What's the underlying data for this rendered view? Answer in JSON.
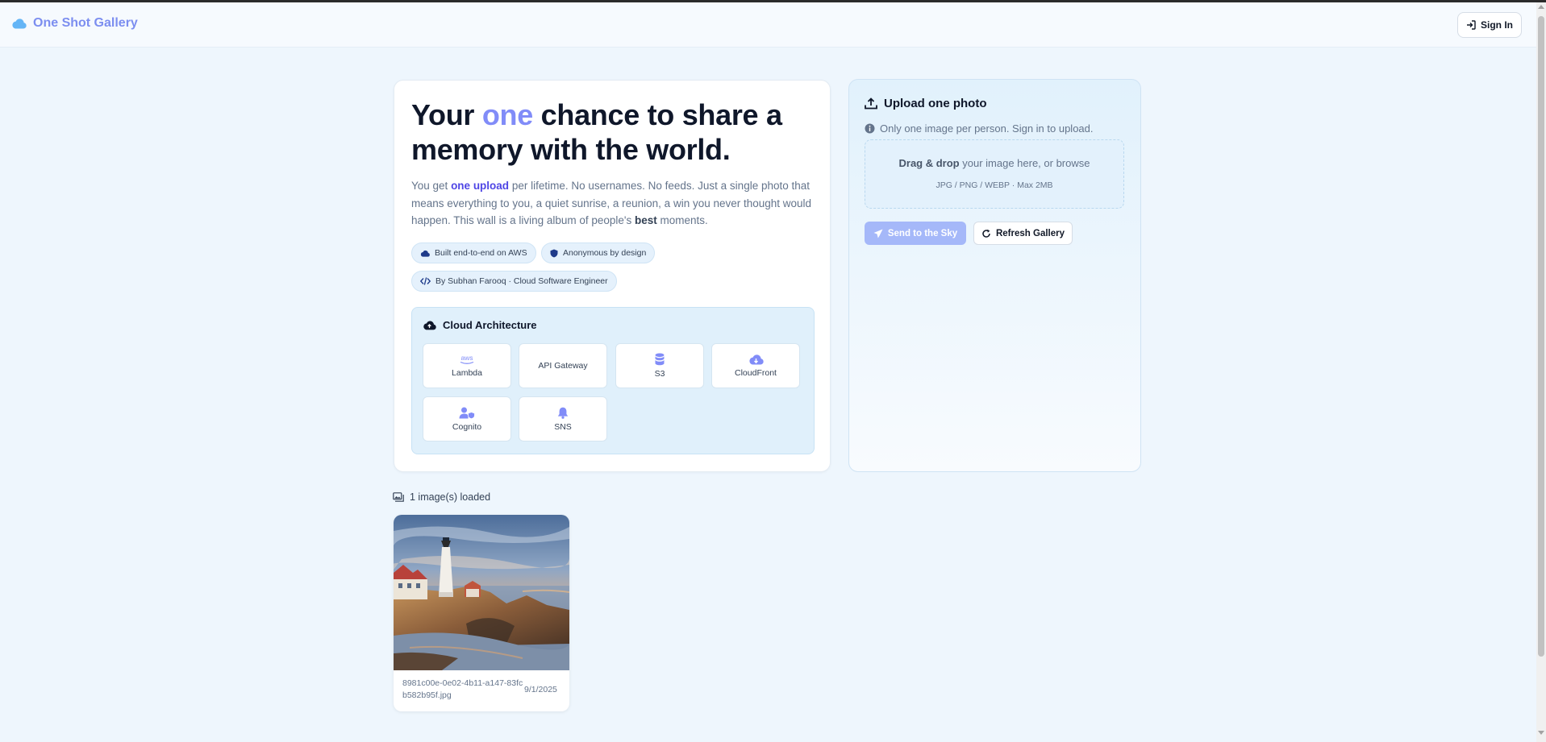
{
  "header": {
    "brand": "One Shot Gallery",
    "sign_in": "Sign In"
  },
  "hero": {
    "title_pre": "Your ",
    "title_accent": "one",
    "title_post": " chance to share a memory with the world.",
    "desc_1": "You get ",
    "desc_link": "one upload",
    "desc_2": " per lifetime. No usernames. No feeds. Just a single photo that means everything to you, a quiet sunrise, a reunion, a win you never thought would happen. This wall is a living album of people's ",
    "desc_bold": "best",
    "desc_3": " moments.",
    "badges": [
      "Built end-to-end on AWS",
      "Anonymous by design",
      "By Subhan Farooq · Cloud Software Engineer"
    ]
  },
  "architecture": {
    "title": "Cloud Architecture",
    "services": [
      {
        "label": "Lambda",
        "icon": "aws-icon"
      },
      {
        "label": "API Gateway",
        "icon": ""
      },
      {
        "label": "S3",
        "icon": "database-icon"
      },
      {
        "label": "CloudFront",
        "icon": "cloud-download-icon"
      },
      {
        "label": "Cognito",
        "icon": "user-shield-icon"
      },
      {
        "label": "SNS",
        "icon": "bell-icon"
      }
    ]
  },
  "upload": {
    "title": "Upload one photo",
    "note": "Only one image per person. Sign in to upload.",
    "drop_bold": "Drag & drop",
    "drop_rest": " your image here, or browse",
    "drop_sub": "JPG / PNG / WEBP · Max 2MB",
    "send": "Send to the Sky",
    "refresh": "Refresh Gallery"
  },
  "gallery": {
    "status": "1 image(s) loaded",
    "images": [
      {
        "name": "8981c00e-0e02-4b11-a147-83fcb582b95f.jpg",
        "date": "9/1/2025"
      }
    ]
  },
  "colors": {
    "accent": "#818cf8",
    "brand": "#7c8ef0",
    "background": "#eef6fd"
  }
}
